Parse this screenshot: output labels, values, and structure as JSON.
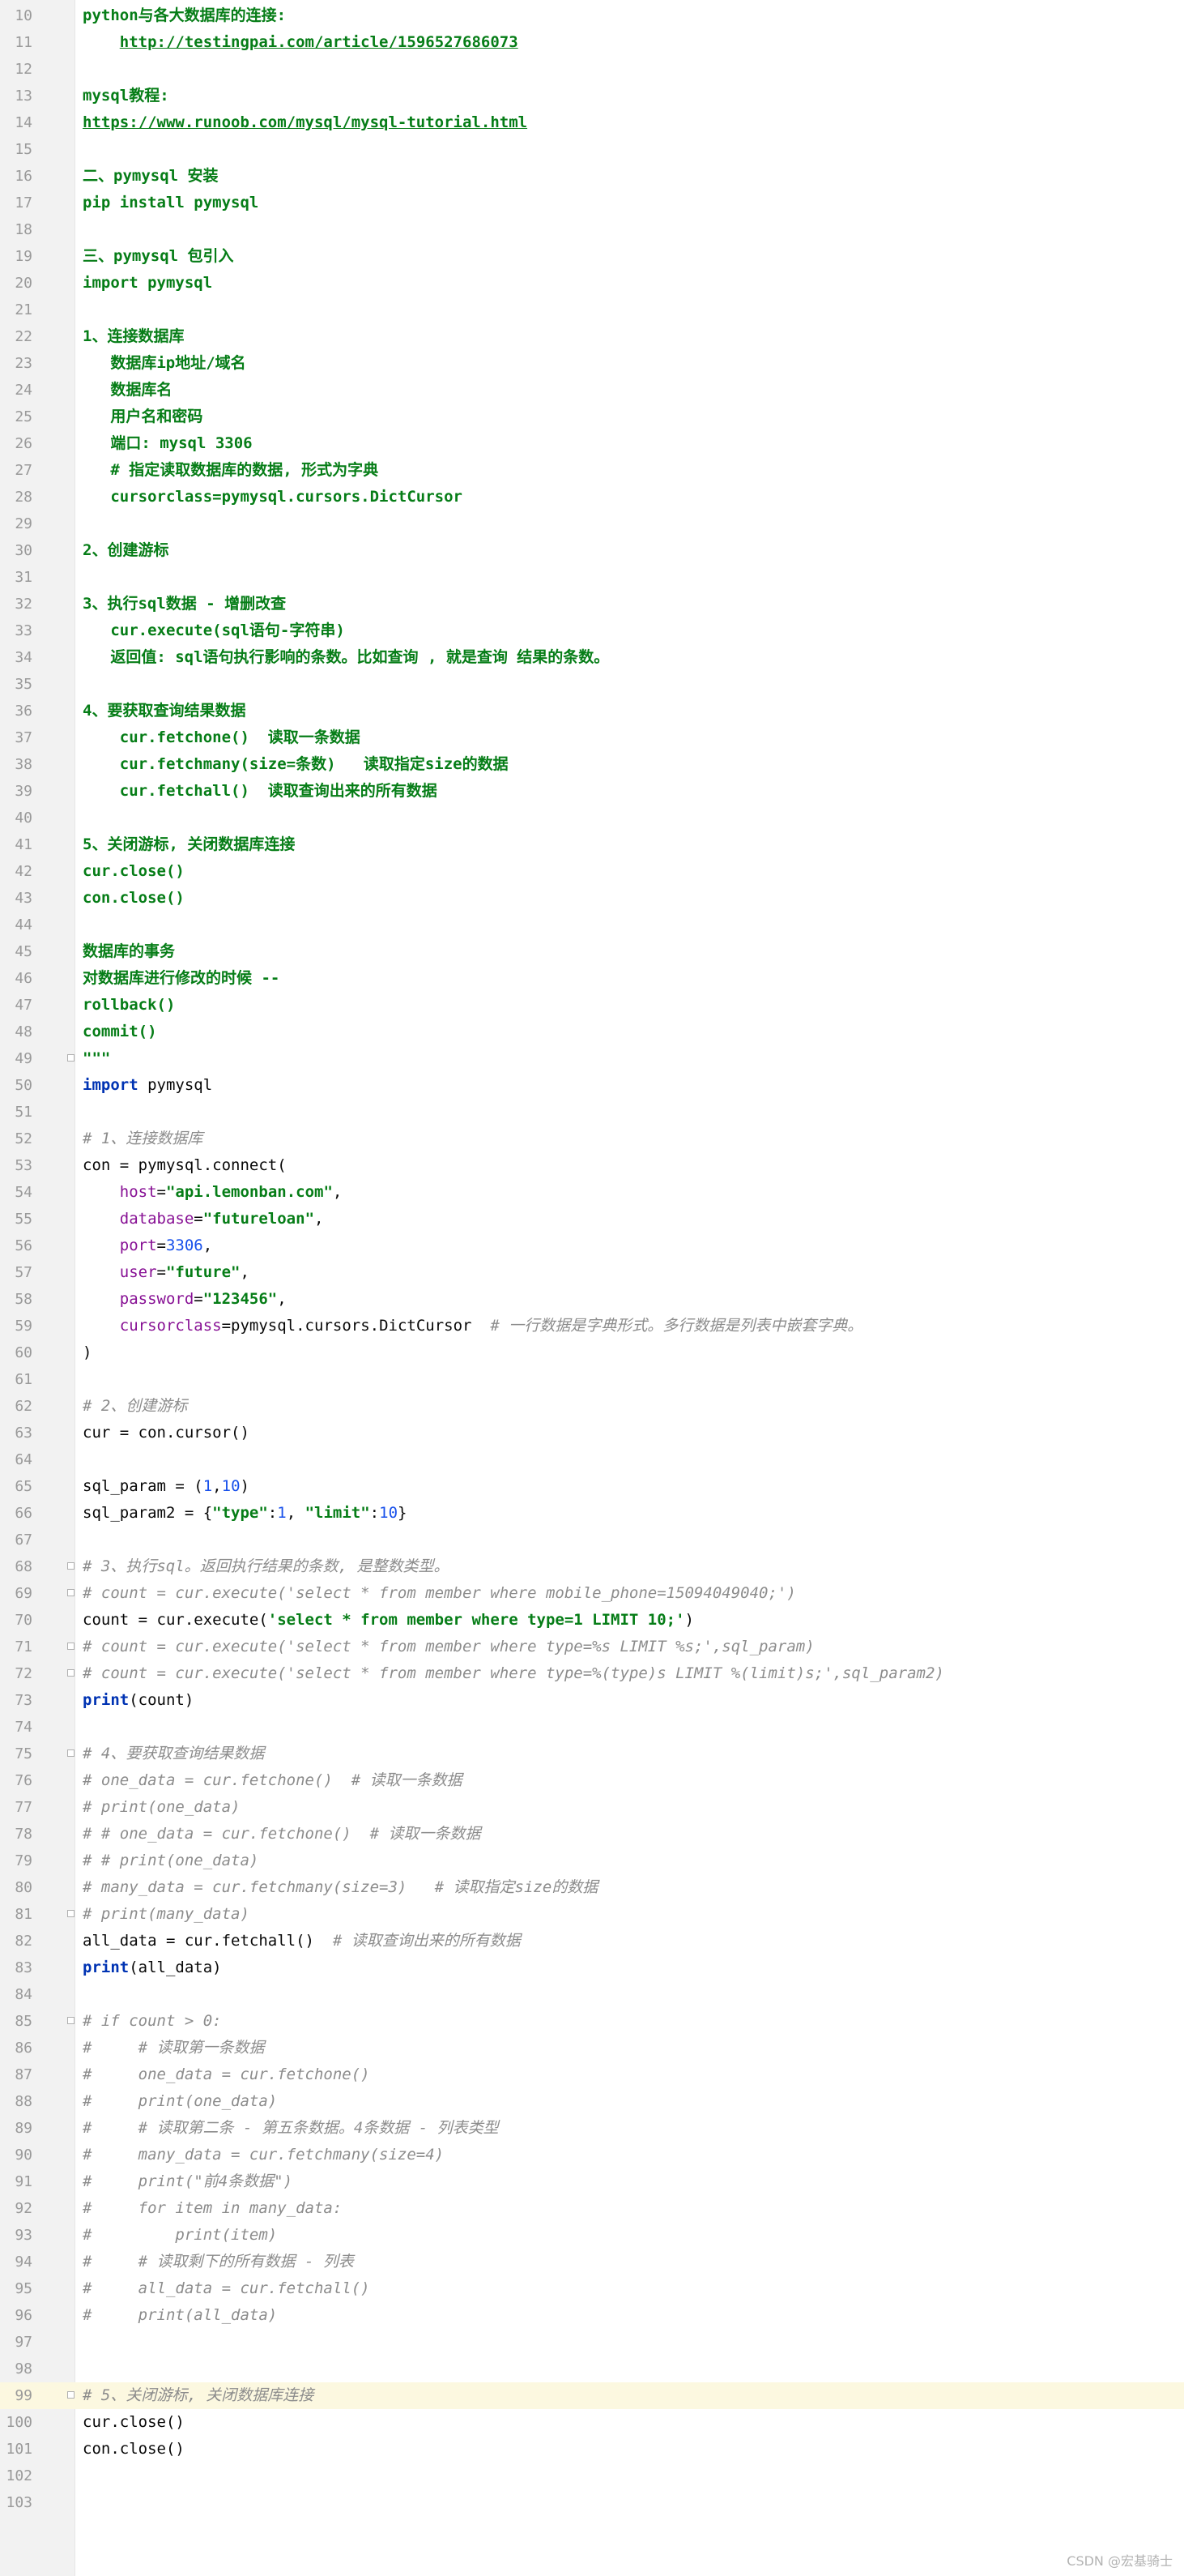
{
  "editor": {
    "current_line": 99,
    "lines": [
      {
        "num": "10",
        "segs": [
          [
            "s",
            "python与各大数据库的连接:"
          ]
        ]
      },
      {
        "num": "11",
        "segs": [
          [
            "s",
            "    "
          ],
          [
            "u",
            "http://testingpai.com/article/1596527686073"
          ]
        ]
      },
      {
        "num": "12",
        "segs": []
      },
      {
        "num": "13",
        "segs": [
          [
            "s",
            "mysql教程:"
          ]
        ]
      },
      {
        "num": "14",
        "segs": [
          [
            "u",
            "https://www.runoob.com/mysql/mysql-tutorial.html"
          ]
        ]
      },
      {
        "num": "15",
        "segs": []
      },
      {
        "num": "16",
        "segs": [
          [
            "s",
            "二、pymysql 安装"
          ]
        ]
      },
      {
        "num": "17",
        "segs": [
          [
            "s",
            "pip install pymysql"
          ]
        ]
      },
      {
        "num": "18",
        "segs": []
      },
      {
        "num": "19",
        "segs": [
          [
            "s",
            "三、pymysql 包引入"
          ]
        ]
      },
      {
        "num": "20",
        "segs": [
          [
            "s",
            "import pymysql"
          ]
        ]
      },
      {
        "num": "21",
        "segs": []
      },
      {
        "num": "22",
        "segs": [
          [
            "s",
            "1、连接数据库"
          ]
        ]
      },
      {
        "num": "23",
        "segs": [
          [
            "s",
            "   数据库ip地址/域名"
          ]
        ]
      },
      {
        "num": "24",
        "segs": [
          [
            "s",
            "   数据库名"
          ]
        ]
      },
      {
        "num": "25",
        "segs": [
          [
            "s",
            "   用户名和密码"
          ]
        ]
      },
      {
        "num": "26",
        "segs": [
          [
            "s",
            "   端口: mysql 3306"
          ]
        ]
      },
      {
        "num": "27",
        "segs": [
          [
            "s",
            "   # 指定读取数据库的数据, 形式为字典"
          ]
        ]
      },
      {
        "num": "28",
        "segs": [
          [
            "s",
            "   cursorclass=pymysql.cursors.DictCursor"
          ]
        ]
      },
      {
        "num": "29",
        "segs": []
      },
      {
        "num": "30",
        "segs": [
          [
            "s",
            "2、创建游标"
          ]
        ]
      },
      {
        "num": "31",
        "segs": []
      },
      {
        "num": "32",
        "segs": [
          [
            "s",
            "3、执行sql数据 - 增删改查"
          ]
        ]
      },
      {
        "num": "33",
        "segs": [
          [
            "s",
            "   cur.execute(sql语句-字符串)"
          ]
        ]
      },
      {
        "num": "34",
        "segs": [
          [
            "s",
            "   返回值: sql语句执行影响的条数。比如查询 , 就是查询 结果的条数。"
          ]
        ]
      },
      {
        "num": "35",
        "segs": []
      },
      {
        "num": "36",
        "segs": [
          [
            "s",
            "4、要获取查询结果数据"
          ]
        ]
      },
      {
        "num": "37",
        "segs": [
          [
            "s",
            "    cur.fetchone()  读取一条数据"
          ]
        ]
      },
      {
        "num": "38",
        "segs": [
          [
            "s",
            "    cur.fetchmany(size=条数)   读取指定size的数据"
          ]
        ]
      },
      {
        "num": "39",
        "segs": [
          [
            "s",
            "    cur.fetchall()  读取查询出来的所有数据"
          ]
        ]
      },
      {
        "num": "40",
        "segs": []
      },
      {
        "num": "41",
        "segs": [
          [
            "s",
            "5、关闭游标, 关闭数据库连接"
          ]
        ]
      },
      {
        "num": "42",
        "segs": [
          [
            "s",
            "cur.close()"
          ]
        ]
      },
      {
        "num": "43",
        "segs": [
          [
            "s",
            "con.close()"
          ]
        ]
      },
      {
        "num": "44",
        "segs": []
      },
      {
        "num": "45",
        "segs": [
          [
            "s",
            "数据库的事务"
          ]
        ]
      },
      {
        "num": "46",
        "segs": [
          [
            "s",
            "对数据库进行修改的时候 --"
          ]
        ]
      },
      {
        "num": "47",
        "segs": [
          [
            "s",
            "rollback()"
          ]
        ]
      },
      {
        "num": "48",
        "segs": [
          [
            "s",
            "commit()"
          ]
        ]
      },
      {
        "num": "49",
        "fold": true,
        "segs": [
          [
            "s",
            "\"\"\""
          ]
        ]
      },
      {
        "num": "50",
        "segs": [
          [
            "k",
            "import"
          ],
          [
            "",
            " pymysql"
          ]
        ]
      },
      {
        "num": "51",
        "segs": []
      },
      {
        "num": "52",
        "segs": [
          [
            "c",
            "# 1、连接数据库"
          ]
        ]
      },
      {
        "num": "53",
        "segs": [
          [
            "",
            "con = pymysql.connect("
          ]
        ]
      },
      {
        "num": "54",
        "segs": [
          [
            "",
            "    "
          ],
          [
            "p",
            "host"
          ],
          [
            "",
            "="
          ],
          [
            "s",
            "\"api.lemonban.com\""
          ],
          [
            "",
            ","
          ]
        ]
      },
      {
        "num": "55",
        "segs": [
          [
            "",
            "    "
          ],
          [
            "p",
            "database"
          ],
          [
            "",
            "="
          ],
          [
            "s",
            "\"futureloan\""
          ],
          [
            "",
            ","
          ]
        ]
      },
      {
        "num": "56",
        "segs": [
          [
            "",
            "    "
          ],
          [
            "p",
            "port"
          ],
          [
            "",
            "="
          ],
          [
            "n",
            "3306"
          ],
          [
            "",
            ","
          ]
        ]
      },
      {
        "num": "57",
        "segs": [
          [
            "",
            "    "
          ],
          [
            "p",
            "user"
          ],
          [
            "",
            "="
          ],
          [
            "s",
            "\"future\""
          ],
          [
            "",
            ","
          ]
        ]
      },
      {
        "num": "58",
        "segs": [
          [
            "",
            "    "
          ],
          [
            "p",
            "password"
          ],
          [
            "",
            "="
          ],
          [
            "s",
            "\"123456\""
          ],
          [
            "",
            ","
          ]
        ]
      },
      {
        "num": "59",
        "segs": [
          [
            "",
            "    "
          ],
          [
            "p",
            "cursorclass"
          ],
          [
            "",
            "=pymysql.cursors.DictCursor  "
          ],
          [
            "c",
            "# 一行数据是字典形式。多行数据是列表中嵌套字典。"
          ]
        ]
      },
      {
        "num": "60",
        "segs": [
          [
            "",
            ")"
          ]
        ]
      },
      {
        "num": "61",
        "segs": []
      },
      {
        "num": "62",
        "segs": [
          [
            "c",
            "# 2、创建游标"
          ]
        ]
      },
      {
        "num": "63",
        "segs": [
          [
            "",
            "cur = con.cursor()"
          ]
        ]
      },
      {
        "num": "64",
        "segs": []
      },
      {
        "num": "65",
        "segs": [
          [
            "",
            "sql_param = ("
          ],
          [
            "n",
            "1"
          ],
          [
            "",
            ","
          ],
          [
            "n",
            "10"
          ],
          [
            "",
            ")"
          ]
        ]
      },
      {
        "num": "66",
        "segs": [
          [
            "",
            "sql_param2 = {"
          ],
          [
            "s",
            "\"type\""
          ],
          [
            "",
            ":"
          ],
          [
            "n",
            "1"
          ],
          [
            "",
            ", "
          ],
          [
            "s",
            "\"limit\""
          ],
          [
            "",
            ":"
          ],
          [
            "n",
            "10"
          ],
          [
            "",
            "}"
          ]
        ]
      },
      {
        "num": "67",
        "segs": []
      },
      {
        "num": "68",
        "fold": true,
        "segs": [
          [
            "c",
            "# 3、执行sql。返回执行结果的条数, 是整数类型。"
          ]
        ]
      },
      {
        "num": "69",
        "fold": true,
        "segs": [
          [
            "c",
            "# count = cur.execute('select * from member where mobile_phone=15094049040;')"
          ]
        ]
      },
      {
        "num": "70",
        "segs": [
          [
            "",
            "count = cur.execute("
          ],
          [
            "s",
            "'select * from member where type=1 LIMIT 10;'"
          ],
          [
            "",
            ")"
          ]
        ]
      },
      {
        "num": "71",
        "fold": true,
        "segs": [
          [
            "c",
            "# count = cur.execute('select * from member where type=%s LIMIT %s;',sql_param)"
          ]
        ]
      },
      {
        "num": "72",
        "fold": true,
        "segs": [
          [
            "c",
            "# count = cur.execute('select * from member where type=%(type)s LIMIT %(limit)s;',sql_param2)"
          ]
        ]
      },
      {
        "num": "73",
        "segs": [
          [
            "k",
            "print"
          ],
          [
            "",
            "(count)"
          ]
        ]
      },
      {
        "num": "74",
        "segs": []
      },
      {
        "num": "75",
        "fold": true,
        "segs": [
          [
            "c",
            "# 4、要获取查询结果数据"
          ]
        ]
      },
      {
        "num": "76",
        "segs": [
          [
            "c",
            "# one_data = cur.fetchone()  # 读取一条数据"
          ]
        ]
      },
      {
        "num": "77",
        "segs": [
          [
            "c",
            "# print(one_data)"
          ]
        ]
      },
      {
        "num": "78",
        "segs": [
          [
            "c",
            "# # one_data = cur.fetchone()  # 读取一条数据"
          ]
        ]
      },
      {
        "num": "79",
        "segs": [
          [
            "c",
            "# # print(one_data)"
          ]
        ]
      },
      {
        "num": "80",
        "segs": [
          [
            "c",
            "# many_data = cur.fetchmany(size=3)   # 读取指定size的数据"
          ]
        ]
      },
      {
        "num": "81",
        "fold": true,
        "segs": [
          [
            "c",
            "# print(many_data)"
          ]
        ]
      },
      {
        "num": "82",
        "segs": [
          [
            "",
            "all_data = cur.fetchall()  "
          ],
          [
            "c",
            "# 读取查询出来的所有数据"
          ]
        ]
      },
      {
        "num": "83",
        "segs": [
          [
            "k",
            "print"
          ],
          [
            "",
            "(all_data)"
          ]
        ]
      },
      {
        "num": "84",
        "segs": []
      },
      {
        "num": "85",
        "fold": true,
        "segs": [
          [
            "c",
            "# if count > 0:"
          ]
        ]
      },
      {
        "num": "86",
        "segs": [
          [
            "c",
            "#     # 读取第一条数据"
          ]
        ]
      },
      {
        "num": "87",
        "segs": [
          [
            "c",
            "#     one_data = cur.fetchone()"
          ]
        ]
      },
      {
        "num": "88",
        "segs": [
          [
            "c",
            "#     print(one_data)"
          ]
        ]
      },
      {
        "num": "89",
        "segs": [
          [
            "c",
            "#     # 读取第二条 - 第五条数据。4条数据 - 列表类型"
          ]
        ]
      },
      {
        "num": "90",
        "segs": [
          [
            "c",
            "#     many_data = cur.fetchmany(size=4)"
          ]
        ]
      },
      {
        "num": "91",
        "segs": [
          [
            "c",
            "#     print(\"前4条数据\")"
          ]
        ]
      },
      {
        "num": "92",
        "segs": [
          [
            "c",
            "#     for item in many_data:"
          ]
        ]
      },
      {
        "num": "93",
        "segs": [
          [
            "c",
            "#         print(item)"
          ]
        ]
      },
      {
        "num": "94",
        "segs": [
          [
            "c",
            "#     # 读取剩下的所有数据 - 列表"
          ]
        ]
      },
      {
        "num": "95",
        "segs": [
          [
            "c",
            "#     all_data = cur.fetchall()"
          ]
        ]
      },
      {
        "num": "96",
        "segs": [
          [
            "c",
            "#     print(all_data)"
          ]
        ]
      },
      {
        "num": "97",
        "segs": []
      },
      {
        "num": "98",
        "segs": []
      },
      {
        "num": "99",
        "fold": true,
        "segs": [
          [
            "c",
            "# 5、关闭游标, 关闭数据库连接"
          ]
        ]
      },
      {
        "num": "100",
        "segs": [
          [
            "",
            "cur.close()"
          ]
        ]
      },
      {
        "num": "101",
        "segs": [
          [
            "",
            "con.close()"
          ]
        ]
      },
      {
        "num": "102",
        "segs": []
      },
      {
        "num": "103",
        "segs": []
      }
    ]
  },
  "watermark": "CSDN @宏基骑士"
}
